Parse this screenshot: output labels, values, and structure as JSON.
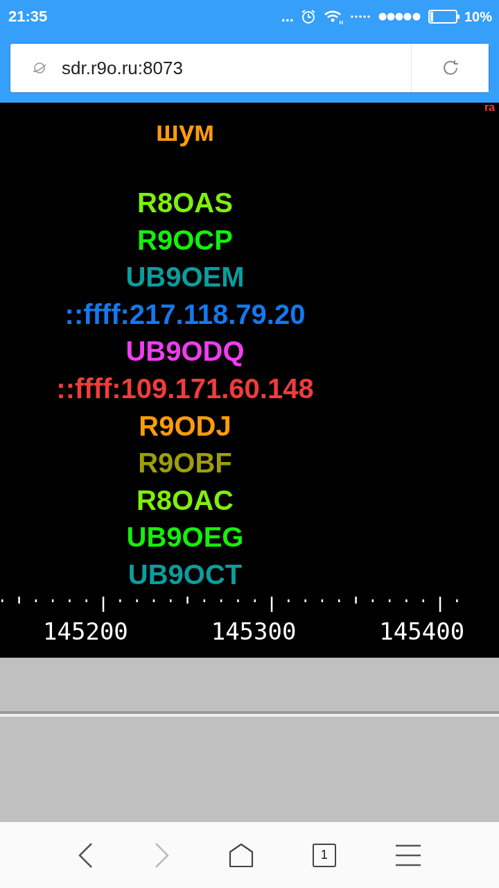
{
  "status_bar": {
    "time": "21:35",
    "more": "...",
    "battery": "10%"
  },
  "address_bar": {
    "url": "sdr.r9o.ru:8073"
  },
  "waterfall": {
    "corner_label": "ra",
    "noise_label": "шум",
    "callsigns": [
      {
        "text": "R8OAS",
        "color": "#7ff00a"
      },
      {
        "text": "R9OCP",
        "color": "#14f00a"
      },
      {
        "text": "UB9OEM",
        "color": "#0a9e9e"
      },
      {
        "text": "::ffff:217.118.79.20",
        "color": "#1478f0"
      },
      {
        "text": "UB9ODQ",
        "color": "#f03cf0"
      },
      {
        "text": "::ffff:109.171.60.148",
        "color": "#f03c3c"
      },
      {
        "text": "R9ODJ",
        "color": "#ff9b0a"
      },
      {
        "text": "R9OBF",
        "color": "#9e9e0a"
      },
      {
        "text": "R8OAC",
        "color": "#7ff00a"
      },
      {
        "text": "UB9OEG",
        "color": "#14f00a"
      },
      {
        "text": "UB9OCT",
        "color": "#0a9e9e"
      }
    ]
  },
  "scale": {
    "labels": [
      "145200",
      "145300",
      "145400"
    ]
  },
  "nav_bar": {
    "forward_disabled": true,
    "tab_count": "1"
  }
}
